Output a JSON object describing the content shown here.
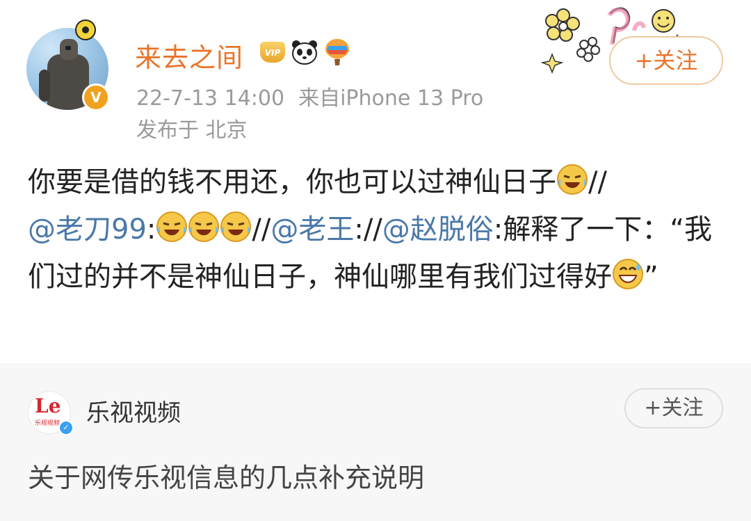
{
  "post": {
    "username": "来去之间",
    "vip_label": "VIP",
    "date": "22-7-13 14:00",
    "source": "来自iPhone 13 Pro",
    "location": "发布于 北京",
    "follow_label": "+关注",
    "content": {
      "line1": "你要是借的钱不用还，你也可以过神仙日子",
      "sep1": "//",
      "mention1": "@老刀99",
      "colon1": ":",
      "sep2": "//",
      "mention2": "@老王",
      "colon2": "://",
      "mention3": "@赵脱俗",
      "text3": ":解释了一下：“我们过的并不是神仙日子，神仙哪里有我们过得好",
      "close_quote": "”"
    },
    "accent_color": "#e8742b",
    "mention_color": "#4a78a8"
  },
  "repost": {
    "logo_text": "Le",
    "logo_sub": "乐视视频",
    "name": "乐视视频",
    "follow_label": "+关注",
    "text": "关于网传乐视信息的几点补充说明"
  },
  "icons": [
    "avatar",
    "camera-badge-icon",
    "verified-icon",
    "vip-badge-icon",
    "panda-icon",
    "balloon-icon",
    "laugh-cry-emoji-icon",
    "sticker-decoration"
  ]
}
